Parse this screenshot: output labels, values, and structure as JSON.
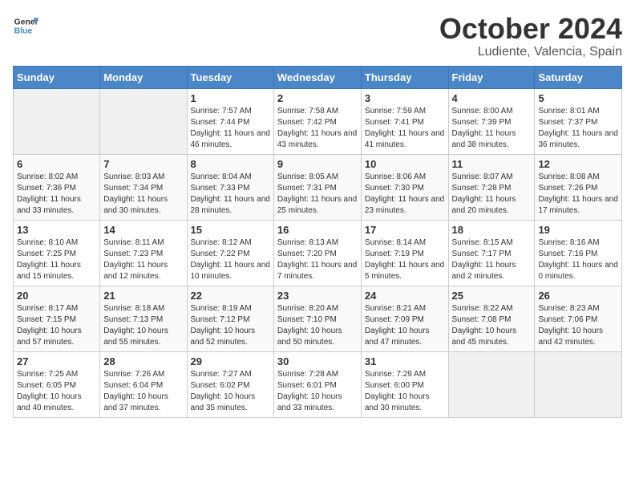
{
  "logo": {
    "line1": "General",
    "line2": "Blue"
  },
  "title": "October 2024",
  "subtitle": "Ludiente, Valencia, Spain",
  "days": [
    "Sunday",
    "Monday",
    "Tuesday",
    "Wednesday",
    "Thursday",
    "Friday",
    "Saturday"
  ],
  "weeks": [
    [
      {
        "date": "",
        "info": ""
      },
      {
        "date": "",
        "info": ""
      },
      {
        "date": "1",
        "info": "Sunrise: 7:57 AM\nSunset: 7:44 PM\nDaylight: 11 hours and 46 minutes."
      },
      {
        "date": "2",
        "info": "Sunrise: 7:58 AM\nSunset: 7:42 PM\nDaylight: 11 hours and 43 minutes."
      },
      {
        "date": "3",
        "info": "Sunrise: 7:59 AM\nSunset: 7:41 PM\nDaylight: 11 hours and 41 minutes."
      },
      {
        "date": "4",
        "info": "Sunrise: 8:00 AM\nSunset: 7:39 PM\nDaylight: 11 hours and 38 minutes."
      },
      {
        "date": "5",
        "info": "Sunrise: 8:01 AM\nSunset: 7:37 PM\nDaylight: 11 hours and 36 minutes."
      }
    ],
    [
      {
        "date": "6",
        "info": "Sunrise: 8:02 AM\nSunset: 7:36 PM\nDaylight: 11 hours and 33 minutes."
      },
      {
        "date": "7",
        "info": "Sunrise: 8:03 AM\nSunset: 7:34 PM\nDaylight: 11 hours and 30 minutes."
      },
      {
        "date": "8",
        "info": "Sunrise: 8:04 AM\nSunset: 7:33 PM\nDaylight: 11 hours and 28 minutes."
      },
      {
        "date": "9",
        "info": "Sunrise: 8:05 AM\nSunset: 7:31 PM\nDaylight: 11 hours and 25 minutes."
      },
      {
        "date": "10",
        "info": "Sunrise: 8:06 AM\nSunset: 7:30 PM\nDaylight: 11 hours and 23 minutes."
      },
      {
        "date": "11",
        "info": "Sunrise: 8:07 AM\nSunset: 7:28 PM\nDaylight: 11 hours and 20 minutes."
      },
      {
        "date": "12",
        "info": "Sunrise: 8:08 AM\nSunset: 7:26 PM\nDaylight: 11 hours and 17 minutes."
      }
    ],
    [
      {
        "date": "13",
        "info": "Sunrise: 8:10 AM\nSunset: 7:25 PM\nDaylight: 11 hours and 15 minutes."
      },
      {
        "date": "14",
        "info": "Sunrise: 8:11 AM\nSunset: 7:23 PM\nDaylight: 11 hours and 12 minutes."
      },
      {
        "date": "15",
        "info": "Sunrise: 8:12 AM\nSunset: 7:22 PM\nDaylight: 11 hours and 10 minutes."
      },
      {
        "date": "16",
        "info": "Sunrise: 8:13 AM\nSunset: 7:20 PM\nDaylight: 11 hours and 7 minutes."
      },
      {
        "date": "17",
        "info": "Sunrise: 8:14 AM\nSunset: 7:19 PM\nDaylight: 11 hours and 5 minutes."
      },
      {
        "date": "18",
        "info": "Sunrise: 8:15 AM\nSunset: 7:17 PM\nDaylight: 11 hours and 2 minutes."
      },
      {
        "date": "19",
        "info": "Sunrise: 8:16 AM\nSunset: 7:16 PM\nDaylight: 11 hours and 0 minutes."
      }
    ],
    [
      {
        "date": "20",
        "info": "Sunrise: 8:17 AM\nSunset: 7:15 PM\nDaylight: 10 hours and 57 minutes."
      },
      {
        "date": "21",
        "info": "Sunrise: 8:18 AM\nSunset: 7:13 PM\nDaylight: 10 hours and 55 minutes."
      },
      {
        "date": "22",
        "info": "Sunrise: 8:19 AM\nSunset: 7:12 PM\nDaylight: 10 hours and 52 minutes."
      },
      {
        "date": "23",
        "info": "Sunrise: 8:20 AM\nSunset: 7:10 PM\nDaylight: 10 hours and 50 minutes."
      },
      {
        "date": "24",
        "info": "Sunrise: 8:21 AM\nSunset: 7:09 PM\nDaylight: 10 hours and 47 minutes."
      },
      {
        "date": "25",
        "info": "Sunrise: 8:22 AM\nSunset: 7:08 PM\nDaylight: 10 hours and 45 minutes."
      },
      {
        "date": "26",
        "info": "Sunrise: 8:23 AM\nSunset: 7:06 PM\nDaylight: 10 hours and 42 minutes."
      }
    ],
    [
      {
        "date": "27",
        "info": "Sunrise: 7:25 AM\nSunset: 6:05 PM\nDaylight: 10 hours and 40 minutes."
      },
      {
        "date": "28",
        "info": "Sunrise: 7:26 AM\nSunset: 6:04 PM\nDaylight: 10 hours and 37 minutes."
      },
      {
        "date": "29",
        "info": "Sunrise: 7:27 AM\nSunset: 6:02 PM\nDaylight: 10 hours and 35 minutes."
      },
      {
        "date": "30",
        "info": "Sunrise: 7:28 AM\nSunset: 6:01 PM\nDaylight: 10 hours and 33 minutes."
      },
      {
        "date": "31",
        "info": "Sunrise: 7:29 AM\nSunset: 6:00 PM\nDaylight: 10 hours and 30 minutes."
      },
      {
        "date": "",
        "info": ""
      },
      {
        "date": "",
        "info": ""
      }
    ]
  ]
}
